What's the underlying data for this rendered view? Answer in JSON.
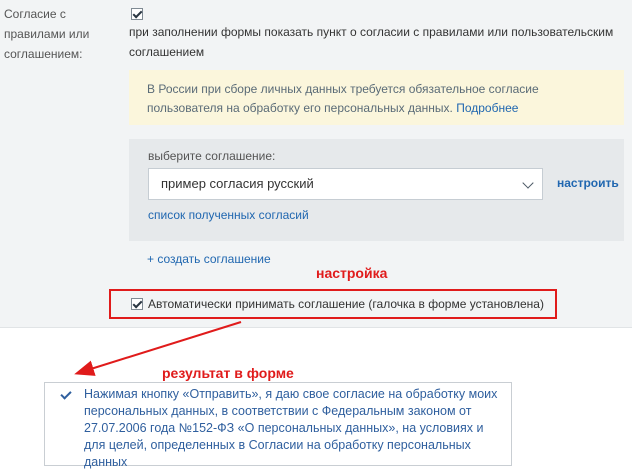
{
  "settings": {
    "label": "Согласие с правилами или соглашением:",
    "enable_description": "при заполнении формы показать пункт о согласии с правилами или пользовательским соглашением",
    "notice_text": "В России при сборе личных данных требуется обязательное согласие пользователя на обработку его персональных данных.",
    "notice_link": "Подробнее",
    "select_label": "выберите соглашение:",
    "select_value": "пример согласия русский",
    "configure_link": "настроить",
    "received_link": "список полученных согласий",
    "create_link": "+ создать соглашение",
    "auto_accept_label": "Автоматически принимать соглашение (галочка в форме установлена)"
  },
  "annotations": {
    "setup_label": "настройка",
    "result_label": "результат в форме",
    "colors": {
      "annotation": "#e01b1b",
      "link": "#2067b0"
    }
  },
  "form_result": {
    "consent_text": "Нажимая кнопку «Отправить», я даю свое согласие на обработку моих персональных данных, в соответствии с Федеральным законом от 27.07.2006 года №152-ФЗ «О персональных данных», на условиях и для целей, определенных в Согласии на обработку персональных данных"
  }
}
